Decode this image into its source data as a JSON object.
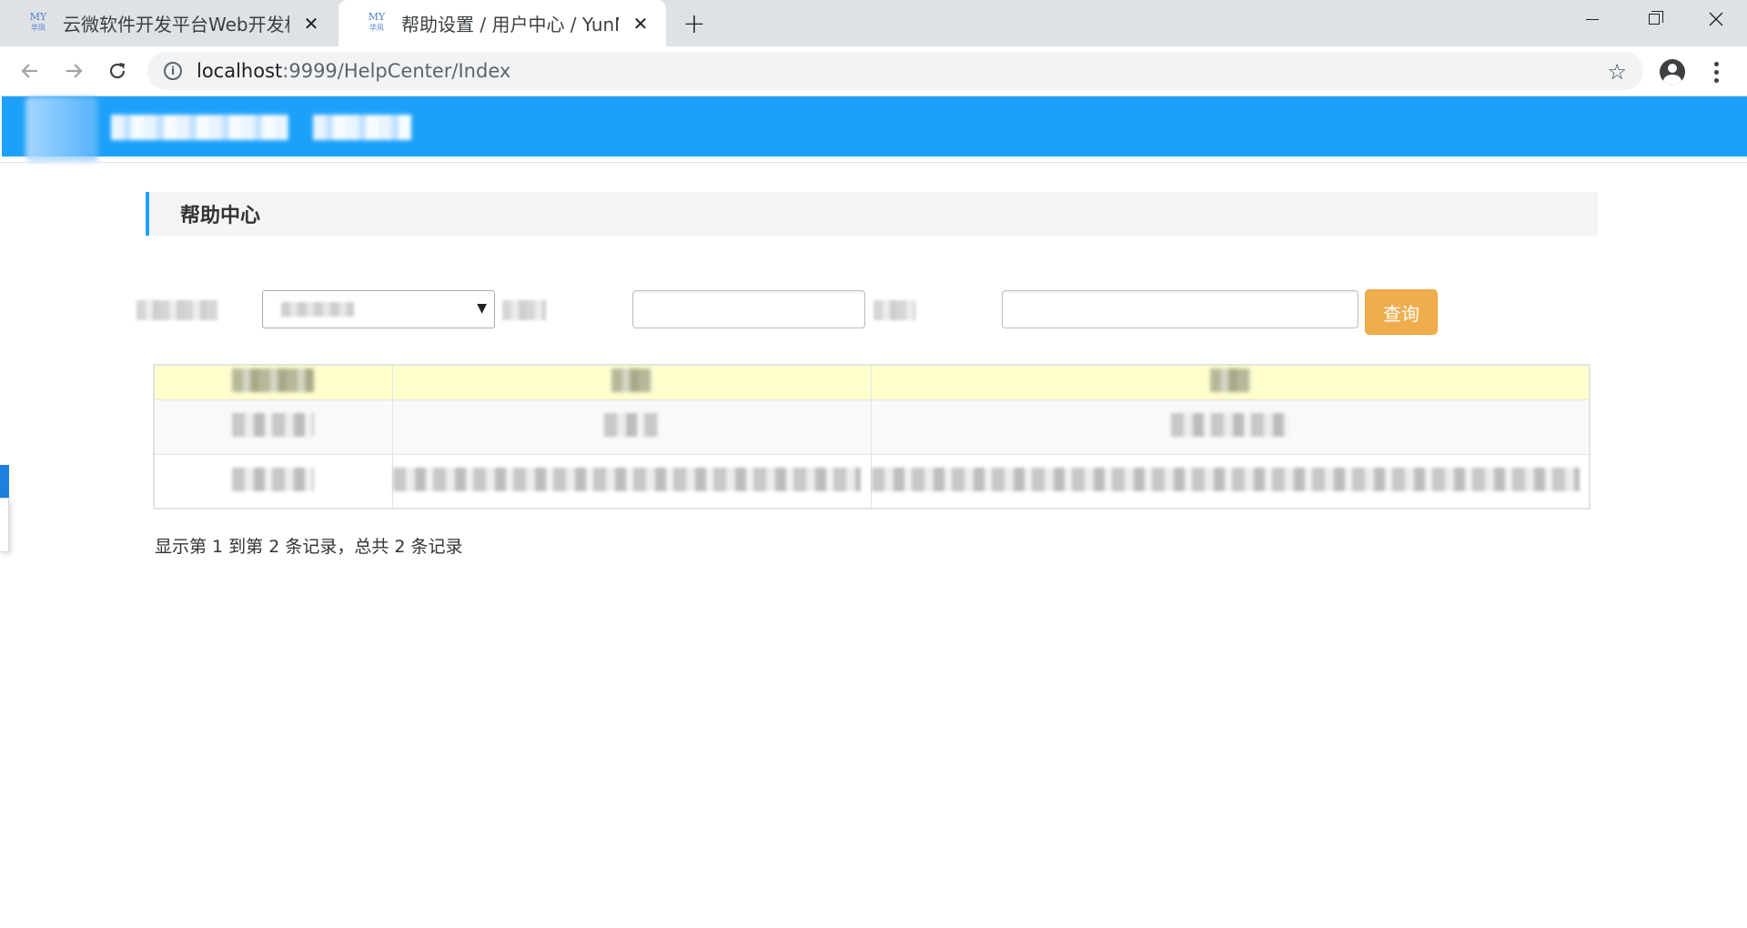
{
  "browser": {
    "tabs": [
      {
        "title": "云微软件开发平台Web开发框架",
        "favicon_top": "MY",
        "favicon_bottom": "华凤",
        "active": false
      },
      {
        "title": "帮助设置 / 用户中心 / YunMFra",
        "favicon_top": "MY",
        "favicon_bottom": "华凤",
        "active": true
      }
    ],
    "new_tab_glyph": "+",
    "close_glyph": "✕",
    "url_host": "localhost",
    "url_path": ":9999/HelpCenter/Index"
  },
  "page": {
    "section_title": "帮助中心",
    "query_button": "查询",
    "pager_info": "显示第 1 到第 2 条记录，总共 2 条记录",
    "select_value": "",
    "table": {
      "headers": [
        "",
        "",
        ""
      ],
      "rows": [
        [
          "",
          "",
          ""
        ],
        [
          "",
          "",
          ""
        ]
      ]
    }
  },
  "colors": {
    "header_blue": "#1da1f8",
    "query_button": "#f0ad4e",
    "table_header": "#ffffce"
  }
}
